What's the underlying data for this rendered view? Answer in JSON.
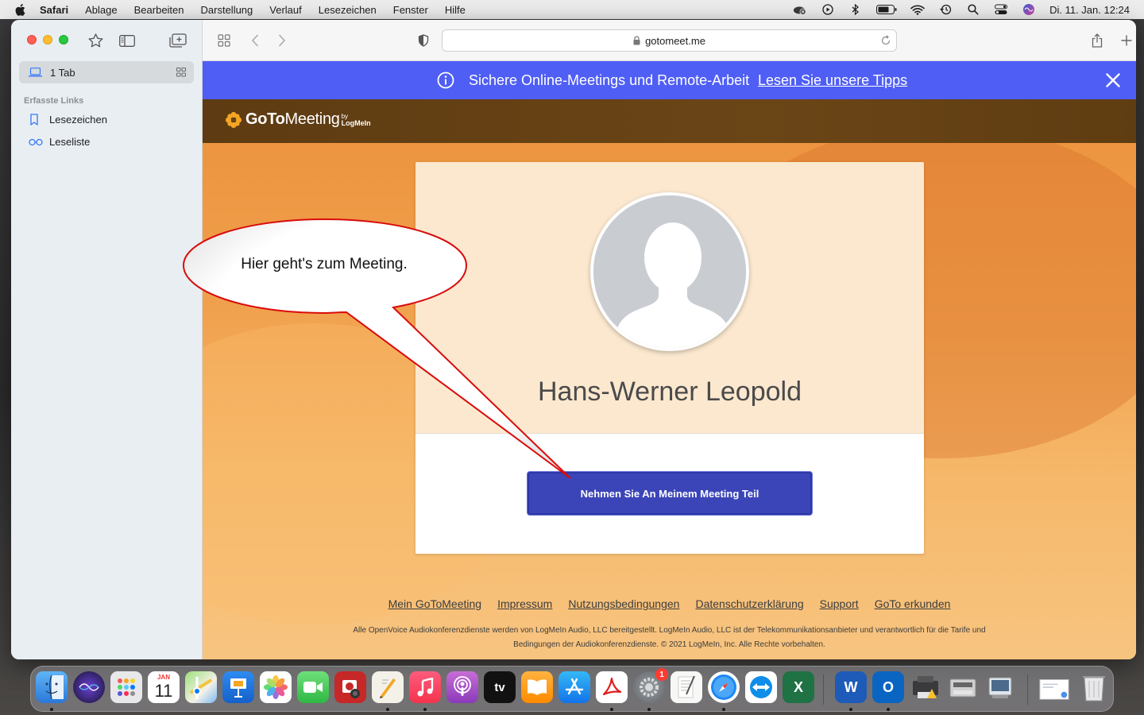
{
  "menubar": {
    "app_name": "Safari",
    "items": [
      "Ablage",
      "Bearbeiten",
      "Darstellung",
      "Verlauf",
      "Lesezeichen",
      "Fenster",
      "Hilfe"
    ],
    "clock": "Di. 11. Jan.  12:24"
  },
  "sidebar": {
    "tab_count_label": "1 Tab",
    "section_title": "Erfasste Links",
    "items": [
      {
        "label": "Lesezeichen",
        "icon": "bookmark-icon"
      },
      {
        "label": "Leseliste",
        "icon": "reading-list-icon"
      }
    ]
  },
  "toolbar": {
    "url": "gotomeet.me"
  },
  "banner": {
    "text": "Sichere Online-Meetings und Remote-Arbeit",
    "link": "Lesen Sie unsere Tipps",
    "color": "#4f5ef4"
  },
  "brand": {
    "name_bold": "GoTo",
    "name_regular": "Meeting",
    "by": "by",
    "company": "LogMeIn"
  },
  "card": {
    "host_name": "Hans-Werner Leopold",
    "join_button": "Nehmen Sie An Meinem Meeting Teil",
    "button_color": "#3b45b8"
  },
  "footer": {
    "links": [
      "Mein GoToMeeting",
      "Impressum",
      "Nutzungsbedingungen",
      "Datenschutzerklärung",
      "Support",
      "GoTo erkunden"
    ],
    "note_line1": "Alle OpenVoice Audiokonferenzdienste werden von LogMeIn Audio, LLC bereitgestellt. LogMeIn Audio, LLC ist der Telekommunikationsanbieter und verantwortlich für die Tarife und",
    "note_line2": "Bedingungen der Audiokonferenzdienste. © 2021 LogMeIn, Inc. Alle Rechte vorbehalten."
  },
  "callout": {
    "text": "Hier geht's zum Meeting."
  },
  "dock": {
    "calendar_month": "JAN",
    "calendar_day": "11",
    "settings_badge": "1",
    "tv_label": "tv",
    "word_letter": "W",
    "excel_letter": "X",
    "outlook_letter": "O",
    "icons": [
      "finder-icon",
      "siri-icon",
      "launchpad-icon",
      "calendar-icon",
      "maps-icon",
      "keynote-icon",
      "photos-icon",
      "facetime-icon",
      "photo-booth-icon",
      "pages-icon",
      "music-icon",
      "podcasts-icon",
      "apple-tv-icon",
      "books-icon",
      "app-store-icon",
      "acrobat-icon",
      "system-preferences-icon",
      "textedit-icon",
      "safari-icon",
      "teamviewer-icon",
      "excel-icon",
      "word-icon",
      "outlook-icon",
      "printer-icon",
      "scanner-icon",
      "preview-icon",
      "downloads-stack-icon",
      "trash-icon"
    ]
  }
}
